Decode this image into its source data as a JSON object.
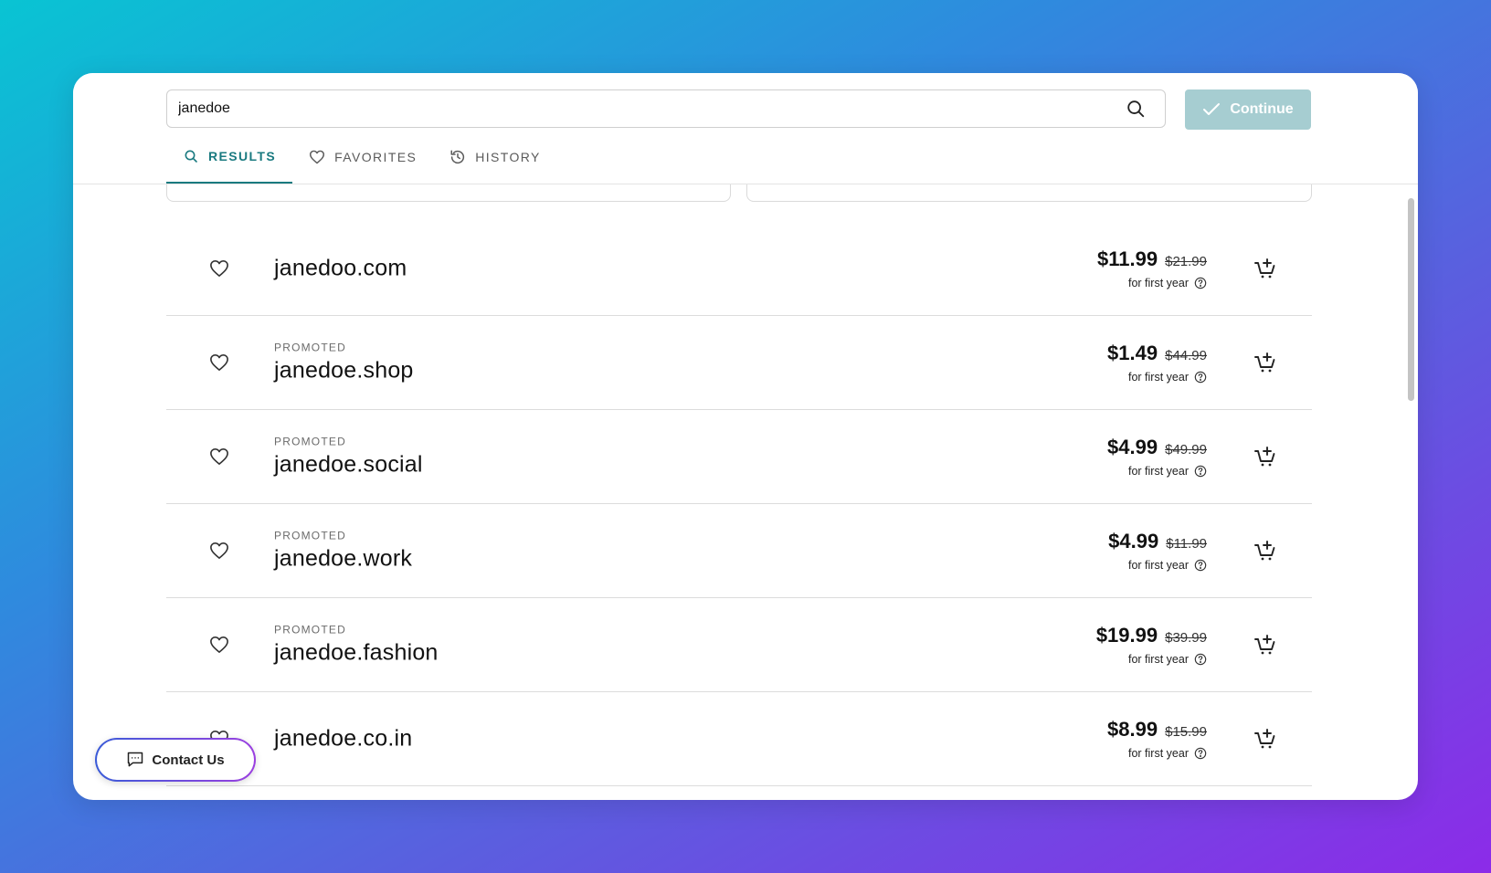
{
  "search": {
    "value": "janedoe",
    "placeholder": ""
  },
  "toolbar": {
    "continue_label": "Continue"
  },
  "tabs": [
    {
      "label": "RESULTS",
      "icon": "search-icon",
      "active": true
    },
    {
      "label": "FAVORITES",
      "icon": "heart-icon",
      "active": false
    },
    {
      "label": "HISTORY",
      "icon": "history-icon",
      "active": false
    }
  ],
  "results": [
    {
      "promo": "",
      "domain": "janedoo.com",
      "price": "$11.99",
      "old_price": "$21.99",
      "note": "for first year"
    },
    {
      "promo": "PROMOTED",
      "domain": "janedoe.shop",
      "price": "$1.49",
      "old_price": "$44.99",
      "note": "for first year"
    },
    {
      "promo": "PROMOTED",
      "domain": "janedoe.social",
      "price": "$4.99",
      "old_price": "$49.99",
      "note": "for first year"
    },
    {
      "promo": "PROMOTED",
      "domain": "janedoe.work",
      "price": "$4.99",
      "old_price": "$11.99",
      "note": "for first year"
    },
    {
      "promo": "PROMOTED",
      "domain": "janedoe.fashion",
      "price": "$19.99",
      "old_price": "$39.99",
      "note": "for first year"
    },
    {
      "promo": "",
      "domain": "janedoe.co.in",
      "price": "$8.99",
      "old_price": "$15.99",
      "note": "for first year"
    }
  ],
  "contact": {
    "label": "Contact Us"
  },
  "colors": {
    "accent": "#1a7a80",
    "continue_bg": "#a6cdd1",
    "text": "#111111"
  }
}
